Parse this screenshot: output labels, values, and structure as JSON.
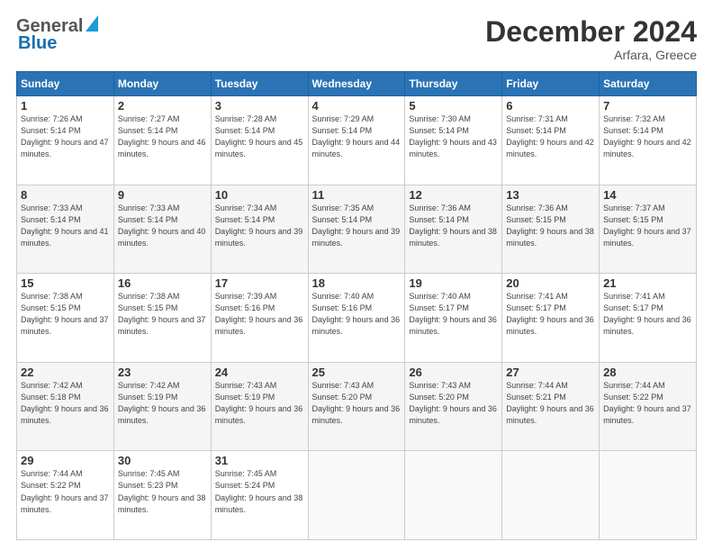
{
  "header": {
    "logo_general": "General",
    "logo_blue": "Blue",
    "title": "December 2024",
    "subtitle": "Arfara, Greece"
  },
  "days_of_week": [
    "Sunday",
    "Monday",
    "Tuesday",
    "Wednesday",
    "Thursday",
    "Friday",
    "Saturday"
  ],
  "weeks": [
    [
      {
        "day": "1",
        "sunrise": "Sunrise: 7:26 AM",
        "sunset": "Sunset: 5:14 PM",
        "daylight": "Daylight: 9 hours and 47 minutes."
      },
      {
        "day": "2",
        "sunrise": "Sunrise: 7:27 AM",
        "sunset": "Sunset: 5:14 PM",
        "daylight": "Daylight: 9 hours and 46 minutes."
      },
      {
        "day": "3",
        "sunrise": "Sunrise: 7:28 AM",
        "sunset": "Sunset: 5:14 PM",
        "daylight": "Daylight: 9 hours and 45 minutes."
      },
      {
        "day": "4",
        "sunrise": "Sunrise: 7:29 AM",
        "sunset": "Sunset: 5:14 PM",
        "daylight": "Daylight: 9 hours and 44 minutes."
      },
      {
        "day": "5",
        "sunrise": "Sunrise: 7:30 AM",
        "sunset": "Sunset: 5:14 PM",
        "daylight": "Daylight: 9 hours and 43 minutes."
      },
      {
        "day": "6",
        "sunrise": "Sunrise: 7:31 AM",
        "sunset": "Sunset: 5:14 PM",
        "daylight": "Daylight: 9 hours and 42 minutes."
      },
      {
        "day": "7",
        "sunrise": "Sunrise: 7:32 AM",
        "sunset": "Sunset: 5:14 PM",
        "daylight": "Daylight: 9 hours and 42 minutes."
      }
    ],
    [
      {
        "day": "8",
        "sunrise": "Sunrise: 7:33 AM",
        "sunset": "Sunset: 5:14 PM",
        "daylight": "Daylight: 9 hours and 41 minutes."
      },
      {
        "day": "9",
        "sunrise": "Sunrise: 7:33 AM",
        "sunset": "Sunset: 5:14 PM",
        "daylight": "Daylight: 9 hours and 40 minutes."
      },
      {
        "day": "10",
        "sunrise": "Sunrise: 7:34 AM",
        "sunset": "Sunset: 5:14 PM",
        "daylight": "Daylight: 9 hours and 39 minutes."
      },
      {
        "day": "11",
        "sunrise": "Sunrise: 7:35 AM",
        "sunset": "Sunset: 5:14 PM",
        "daylight": "Daylight: 9 hours and 39 minutes."
      },
      {
        "day": "12",
        "sunrise": "Sunrise: 7:36 AM",
        "sunset": "Sunset: 5:14 PM",
        "daylight": "Daylight: 9 hours and 38 minutes."
      },
      {
        "day": "13",
        "sunrise": "Sunrise: 7:36 AM",
        "sunset": "Sunset: 5:15 PM",
        "daylight": "Daylight: 9 hours and 38 minutes."
      },
      {
        "day": "14",
        "sunrise": "Sunrise: 7:37 AM",
        "sunset": "Sunset: 5:15 PM",
        "daylight": "Daylight: 9 hours and 37 minutes."
      }
    ],
    [
      {
        "day": "15",
        "sunrise": "Sunrise: 7:38 AM",
        "sunset": "Sunset: 5:15 PM",
        "daylight": "Daylight: 9 hours and 37 minutes."
      },
      {
        "day": "16",
        "sunrise": "Sunrise: 7:38 AM",
        "sunset": "Sunset: 5:15 PM",
        "daylight": "Daylight: 9 hours and 37 minutes."
      },
      {
        "day": "17",
        "sunrise": "Sunrise: 7:39 AM",
        "sunset": "Sunset: 5:16 PM",
        "daylight": "Daylight: 9 hours and 36 minutes."
      },
      {
        "day": "18",
        "sunrise": "Sunrise: 7:40 AM",
        "sunset": "Sunset: 5:16 PM",
        "daylight": "Daylight: 9 hours and 36 minutes."
      },
      {
        "day": "19",
        "sunrise": "Sunrise: 7:40 AM",
        "sunset": "Sunset: 5:17 PM",
        "daylight": "Daylight: 9 hours and 36 minutes."
      },
      {
        "day": "20",
        "sunrise": "Sunrise: 7:41 AM",
        "sunset": "Sunset: 5:17 PM",
        "daylight": "Daylight: 9 hours and 36 minutes."
      },
      {
        "day": "21",
        "sunrise": "Sunrise: 7:41 AM",
        "sunset": "Sunset: 5:17 PM",
        "daylight": "Daylight: 9 hours and 36 minutes."
      }
    ],
    [
      {
        "day": "22",
        "sunrise": "Sunrise: 7:42 AM",
        "sunset": "Sunset: 5:18 PM",
        "daylight": "Daylight: 9 hours and 36 minutes."
      },
      {
        "day": "23",
        "sunrise": "Sunrise: 7:42 AM",
        "sunset": "Sunset: 5:19 PM",
        "daylight": "Daylight: 9 hours and 36 minutes."
      },
      {
        "day": "24",
        "sunrise": "Sunrise: 7:43 AM",
        "sunset": "Sunset: 5:19 PM",
        "daylight": "Daylight: 9 hours and 36 minutes."
      },
      {
        "day": "25",
        "sunrise": "Sunrise: 7:43 AM",
        "sunset": "Sunset: 5:20 PM",
        "daylight": "Daylight: 9 hours and 36 minutes."
      },
      {
        "day": "26",
        "sunrise": "Sunrise: 7:43 AM",
        "sunset": "Sunset: 5:20 PM",
        "daylight": "Daylight: 9 hours and 36 minutes."
      },
      {
        "day": "27",
        "sunrise": "Sunrise: 7:44 AM",
        "sunset": "Sunset: 5:21 PM",
        "daylight": "Daylight: 9 hours and 36 minutes."
      },
      {
        "day": "28",
        "sunrise": "Sunrise: 7:44 AM",
        "sunset": "Sunset: 5:22 PM",
        "daylight": "Daylight: 9 hours and 37 minutes."
      }
    ],
    [
      {
        "day": "29",
        "sunrise": "Sunrise: 7:44 AM",
        "sunset": "Sunset: 5:22 PM",
        "daylight": "Daylight: 9 hours and 37 minutes."
      },
      {
        "day": "30",
        "sunrise": "Sunrise: 7:45 AM",
        "sunset": "Sunset: 5:23 PM",
        "daylight": "Daylight: 9 hours and 38 minutes."
      },
      {
        "day": "31",
        "sunrise": "Sunrise: 7:45 AM",
        "sunset": "Sunset: 5:24 PM",
        "daylight": "Daylight: 9 hours and 38 minutes."
      },
      null,
      null,
      null,
      null
    ]
  ]
}
